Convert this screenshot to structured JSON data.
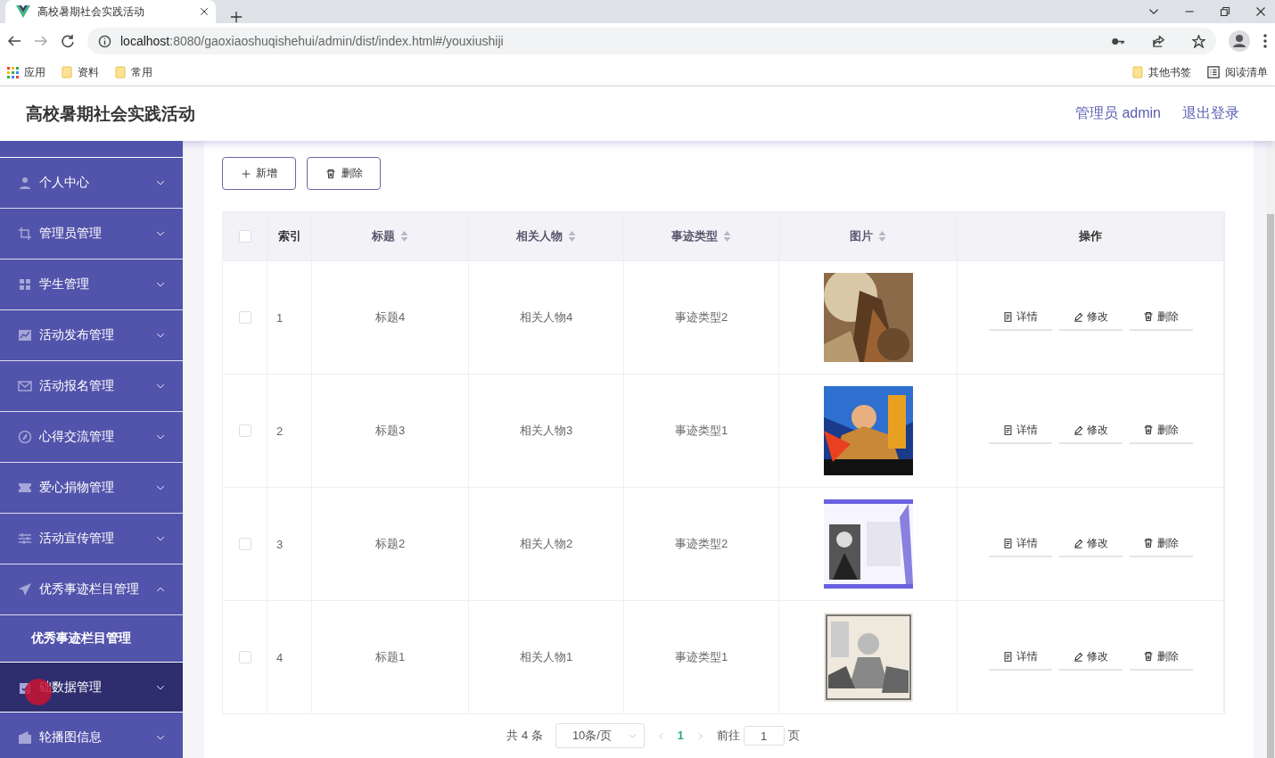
{
  "browser": {
    "tab_title": "高校暑期社会实践活动",
    "url_host": "localhost",
    "url_path": ":8080/gaoxiaoshuqishehui/admin/dist/index.html#/youxiushiji",
    "bookmarks": [
      {
        "label": "应用",
        "kind": "apps"
      },
      {
        "label": "资料",
        "kind": "folder"
      },
      {
        "label": "常用",
        "kind": "folder"
      }
    ],
    "right_bookmarks": [
      {
        "label": "其他书签",
        "kind": "folder"
      },
      {
        "label": "阅读清单",
        "kind": "list"
      }
    ]
  },
  "header": {
    "title": "高校暑期社会实践活动",
    "user": "管理员 admin",
    "logout": "退出登录"
  },
  "sidebar": {
    "items": [
      {
        "label": "个人中心",
        "kind": "user",
        "expanded": false,
        "hovered": false
      },
      {
        "label": "管理员管理",
        "kind": "crop",
        "expanded": false,
        "hovered": false
      },
      {
        "label": "学生管理",
        "kind": "grid",
        "expanded": false,
        "hovered": false
      },
      {
        "label": "活动发布管理",
        "kind": "chart",
        "expanded": false,
        "hovered": false
      },
      {
        "label": "活动报名管理",
        "kind": "mail",
        "expanded": false,
        "hovered": false
      },
      {
        "label": "心得交流管理",
        "kind": "compass",
        "expanded": false,
        "hovered": false
      },
      {
        "label": "爱心捐物管理",
        "kind": "ticket",
        "expanded": false,
        "hovered": false
      },
      {
        "label": "活动宣传管理",
        "kind": "sliders",
        "expanded": false,
        "hovered": false
      },
      {
        "label": "优秀事迹栏目管理",
        "kind": "plane",
        "expanded": true,
        "hovered": false,
        "children": [
          {
            "label": "优秀事迹栏目管理"
          }
        ]
      },
      {
        "label": "础数据管理",
        "kind": "clipboard",
        "expanded": false,
        "hovered": true
      },
      {
        "label": "轮播图信息",
        "kind": "wallet",
        "expanded": false,
        "hovered": false
      }
    ]
  },
  "toolbar": [
    {
      "label": "新增",
      "kind": "add"
    },
    {
      "label": "删除",
      "kind": "delete"
    }
  ],
  "table": {
    "all_checked": false,
    "columns": [
      {
        "label": "索引",
        "sortable": false
      },
      {
        "label": "标题",
        "sortable": true
      },
      {
        "label": "相关人物",
        "sortable": true
      },
      {
        "label": "事迹类型",
        "sortable": true
      },
      {
        "label": "图片",
        "sortable": true
      },
      {
        "label": "操作",
        "sortable": false
      }
    ],
    "rows": [
      {
        "checked": false,
        "index": "1",
        "title": "标题4",
        "person": "相关人物4",
        "type": "事迹类型2",
        "picture": {
          "kind": "picture"
        },
        "actions": [
          {
            "label": "详情",
            "kind": "detail"
          },
          {
            "label": "修改",
            "kind": "edit"
          },
          {
            "label": "删除",
            "kind": "delete"
          }
        ]
      },
      {
        "checked": false,
        "index": "2",
        "title": "标题3",
        "person": "相关人物3",
        "type": "事迹类型1",
        "picture": {
          "kind": "picture"
        },
        "actions": [
          {
            "label": "详情",
            "kind": "detail"
          },
          {
            "label": "修改",
            "kind": "edit"
          },
          {
            "label": "删除",
            "kind": "delete"
          }
        ]
      },
      {
        "checked": false,
        "index": "3",
        "title": "标题2",
        "person": "相关人物2",
        "type": "事迹类型2",
        "picture": {
          "kind": "picture"
        },
        "actions": [
          {
            "label": "详情",
            "kind": "detail"
          },
          {
            "label": "修改",
            "kind": "edit"
          },
          {
            "label": "删除",
            "kind": "delete"
          }
        ]
      },
      {
        "checked": false,
        "index": "4",
        "title": "标题1",
        "person": "相关人物1",
        "type": "事迹类型1",
        "picture": {
          "kind": "picture"
        },
        "actions": [
          {
            "label": "详情",
            "kind": "detail"
          },
          {
            "label": "修改",
            "kind": "edit"
          },
          {
            "label": "删除",
            "kind": "delete"
          }
        ]
      }
    ]
  },
  "pagination": {
    "total": "共 4 条",
    "page_size": "10条/页",
    "pages": [
      {
        "label": "1",
        "selected": true
      }
    ],
    "goto_label": "前往",
    "goto_value": "1",
    "page_suffix": "页"
  }
}
